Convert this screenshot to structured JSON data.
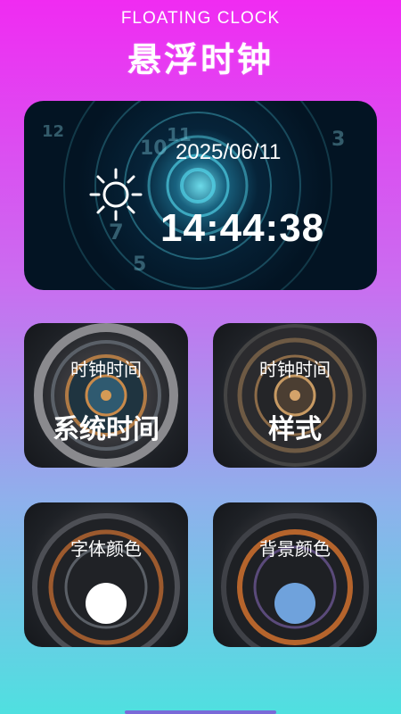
{
  "header": {
    "subtitle": "FLOATING CLOCK",
    "title": "悬浮时钟"
  },
  "clock_preview": {
    "date": "2025/06/11",
    "time": "14:44:38",
    "icon": "sun-icon"
  },
  "cards": {
    "clock_time_1": {
      "label": "时钟时间",
      "value": "系统时间"
    },
    "clock_time_2": {
      "label": "时钟时间",
      "value": "样式"
    },
    "font_color": {
      "label": "字体颜色",
      "swatch": "#ffffff"
    },
    "bg_color": {
      "label": "背景颜色",
      "swatch": "#6fa2dc"
    }
  }
}
